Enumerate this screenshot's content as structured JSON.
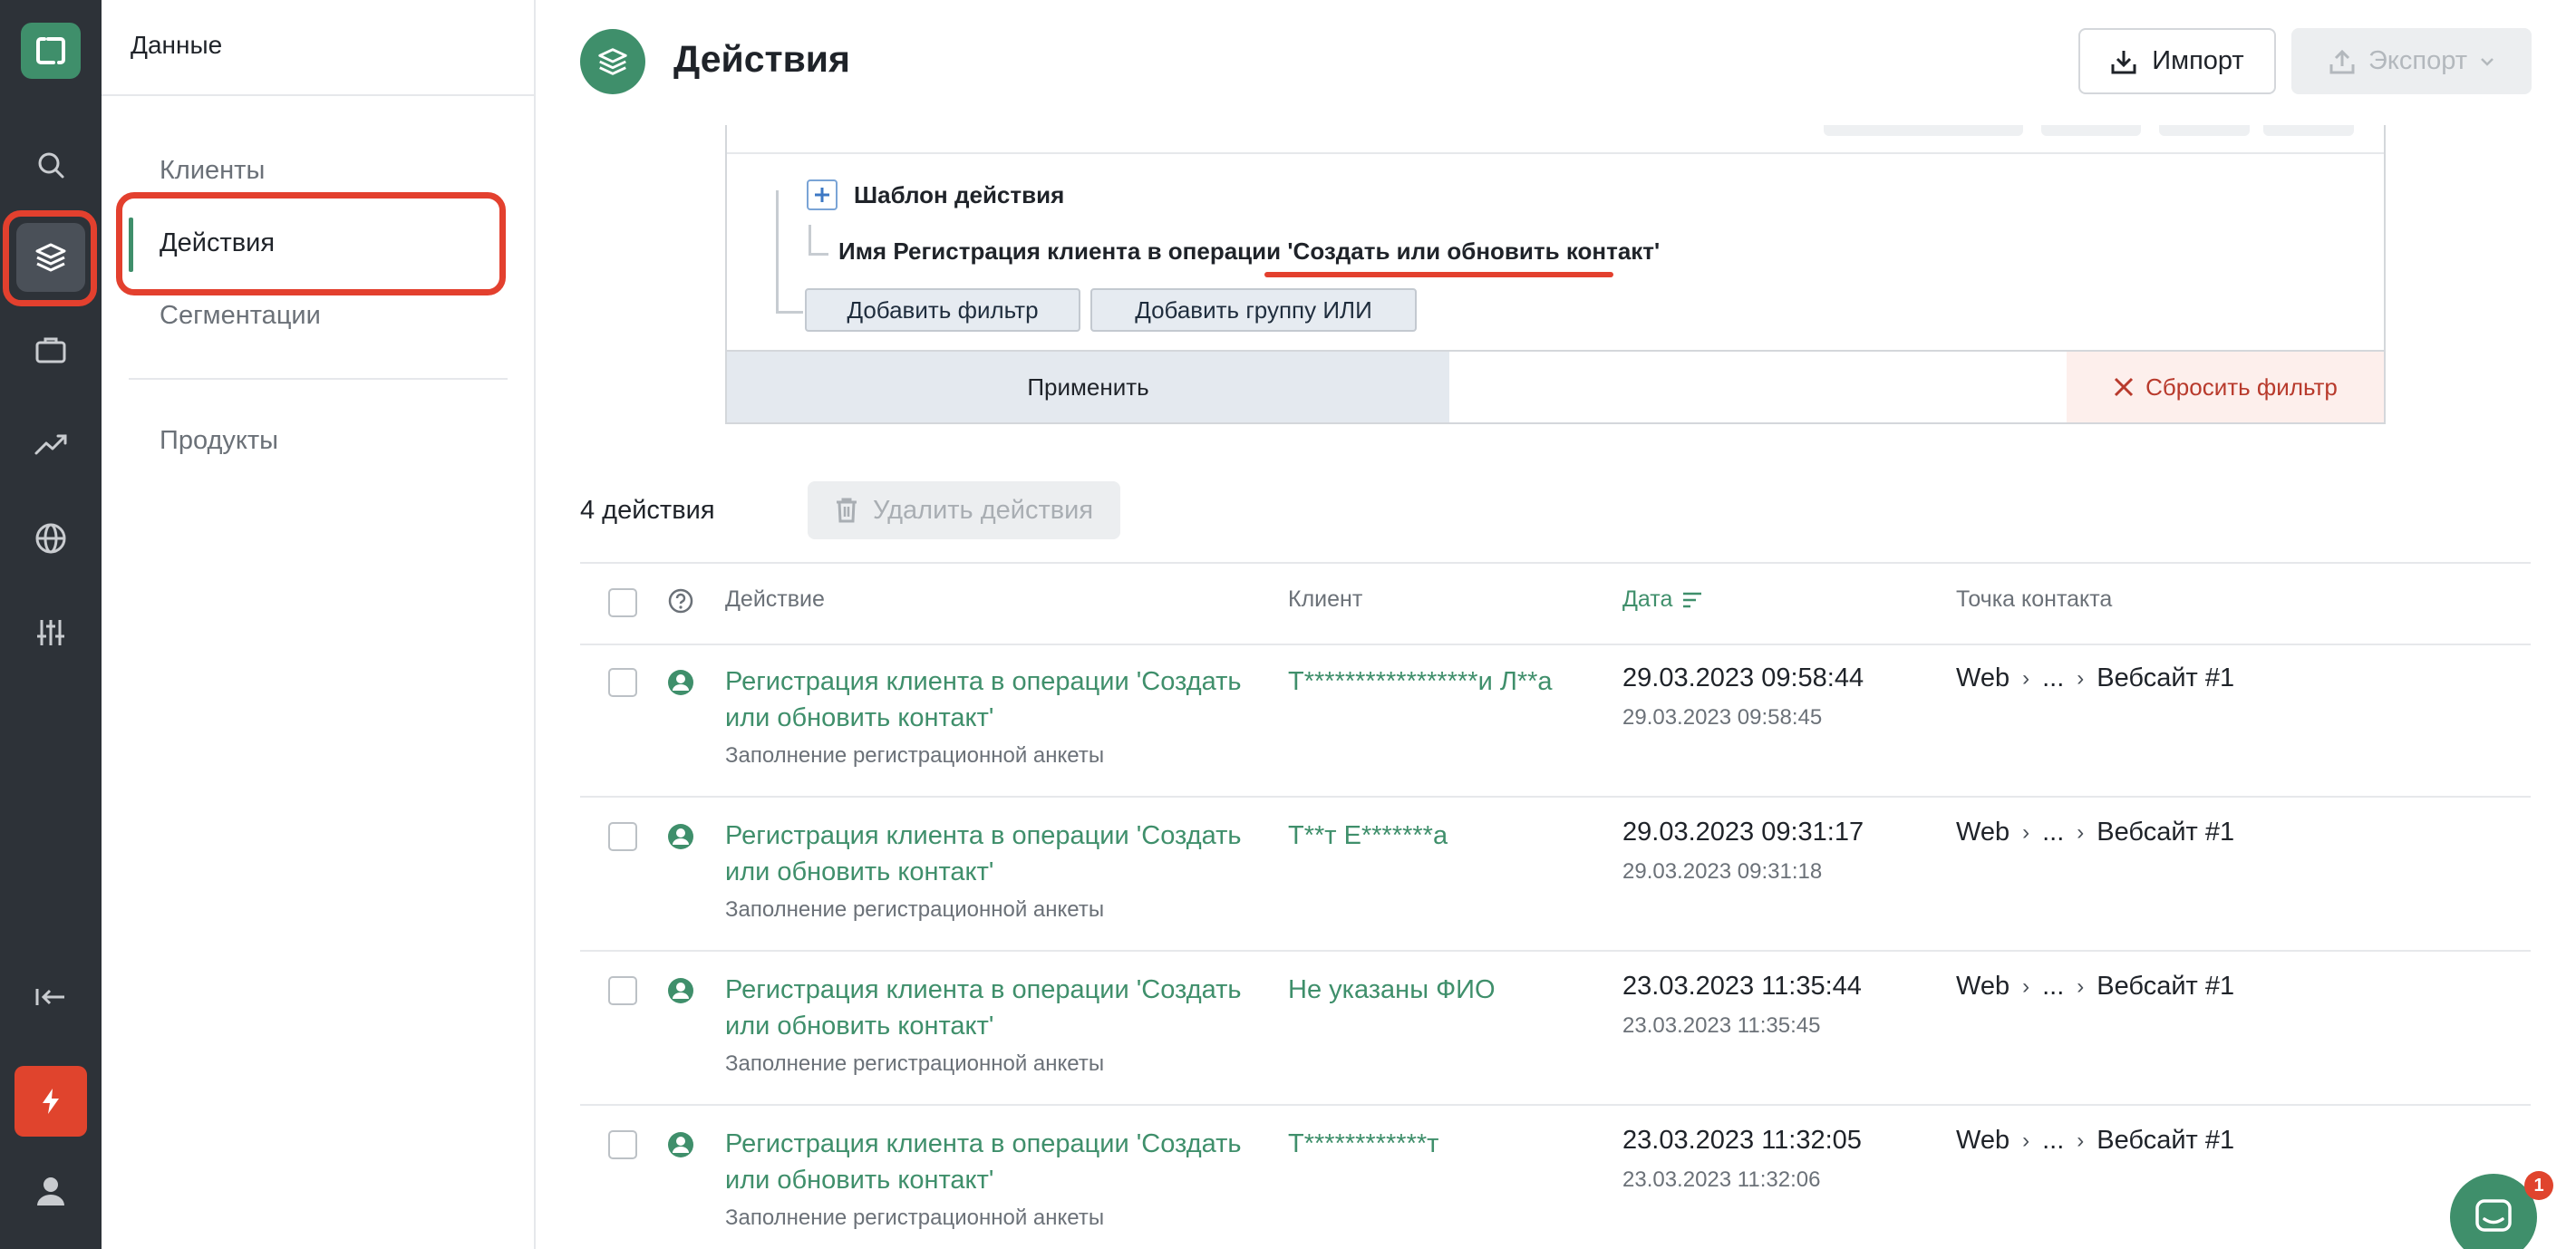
{
  "subnav": {
    "title": "Данные",
    "items": [
      "Клиенты",
      "Действия",
      "Сегментации",
      "Продукты"
    ]
  },
  "header": {
    "title": "Действия",
    "import_label": "Импорт",
    "export_label": "Экспорт"
  },
  "filter": {
    "template_label": "Шаблон действия",
    "condition_label": "Имя Регистрация клиента в операции 'Создать или обновить контакт'",
    "add_filter_label": "Добавить фильтр",
    "add_or_group_label": "Добавить группу ИЛИ",
    "apply_label": "Применить",
    "reset_label": "Сбросить фильтр"
  },
  "list": {
    "count_label": "4 действия",
    "delete_label": "Удалить действия"
  },
  "table": {
    "columns": {
      "action": "Действие",
      "client": "Клиент",
      "date": "Дата",
      "touchpoint": "Точка контакта"
    },
    "rows": [
      {
        "action": "Регистрация клиента в операции 'Создать или обновить контакт'",
        "action_sub": "Заполнение регистрационной анкеты",
        "client": "Т*****************и Л**а",
        "date": "29.03.2023 09:58:44",
        "date_sub": "29.03.2023 09:58:45",
        "touch_1": "Web",
        "touch_2": "...",
        "touch_3": "Вебсайт #1"
      },
      {
        "action": "Регистрация клиента в операции 'Создать или обновить контакт'",
        "action_sub": "Заполнение регистрационной анкеты",
        "client": "Т**т Е*******а",
        "date": "29.03.2023 09:31:17",
        "date_sub": "29.03.2023 09:31:18",
        "touch_1": "Web",
        "touch_2": "...",
        "touch_3": "Вебсайт #1"
      },
      {
        "action": "Регистрация клиента в операции 'Создать или обновить контакт'",
        "action_sub": "Заполнение регистрационной анкеты",
        "client": "Не указаны ФИО",
        "date": "23.03.2023 11:35:44",
        "date_sub": "23.03.2023 11:35:45",
        "touch_1": "Web",
        "touch_2": "...",
        "touch_3": "Вебсайт #1"
      },
      {
        "action": "Регистрация клиента в операции 'Создать или обновить контакт'",
        "action_sub": "Заполнение регистрационной анкеты",
        "client": "Т************т",
        "date": "23.03.2023 11:32:05",
        "date_sub": "23.03.2023 11:32:06",
        "touch_1": "Web",
        "touch_2": "...",
        "touch_3": "Вебсайт #1"
      }
    ]
  },
  "chat": {
    "badge": "1"
  },
  "colors": {
    "accent": "#3f8f6b",
    "highlight": "#e3402e",
    "rail": "#2d3238"
  }
}
